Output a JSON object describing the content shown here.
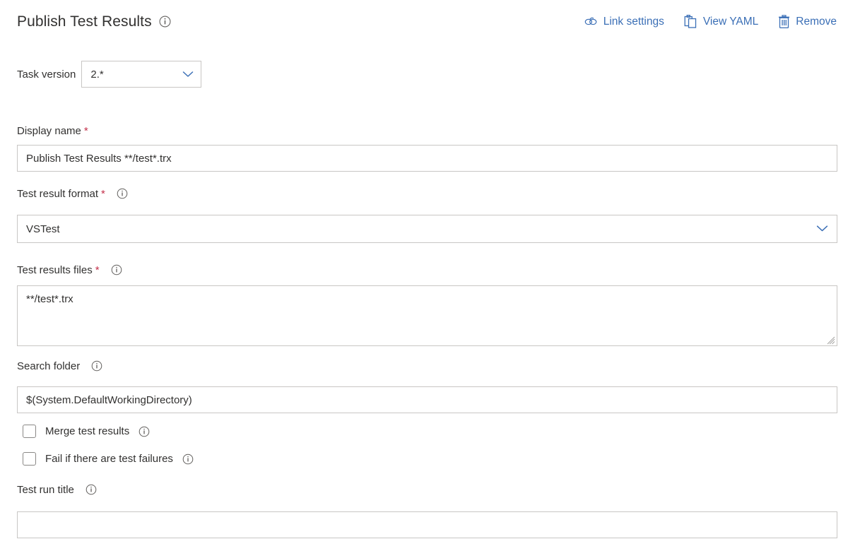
{
  "header": {
    "title": "Publish Test Results",
    "title_info_icon": "info-icon",
    "actions": [
      {
        "label": "Link settings",
        "icon": "link-icon"
      },
      {
        "label": "View YAML",
        "icon": "clipboard-icon"
      },
      {
        "label": "Remove",
        "icon": "trash-icon"
      }
    ]
  },
  "task_version": {
    "label": "Task version",
    "value": "2.*",
    "chevron_icon": "chevron-down-icon"
  },
  "fields": {
    "display_name": {
      "label": "Display name",
      "required_marker": "*",
      "value": "Publish Test Results **/test*.trx"
    },
    "test_result_format": {
      "label": "Test result format",
      "required_marker": "*",
      "info_icon": "info-icon",
      "value": "VSTest",
      "chevron_icon": "chevron-down-icon"
    },
    "test_results_files": {
      "label": "Test results files",
      "required_marker": "*",
      "info_icon": "info-icon",
      "value": "**/test*.trx"
    },
    "search_folder": {
      "label": "Search folder",
      "info_icon": "info-icon",
      "value": "$(System.DefaultWorkingDirectory)"
    },
    "merge_test_results": {
      "label": "Merge test results",
      "info_icon": "info-icon",
      "checked": false
    },
    "fail_if_test_failures": {
      "label": "Fail if there are test failures",
      "info_icon": "info-icon",
      "checked": false
    },
    "test_run_title": {
      "label": "Test run title",
      "info_icon": "info-icon",
      "value": ""
    }
  },
  "colors": {
    "link_blue": "#3b6fb6",
    "required_red": "#c4314b",
    "border_grey": "#c8c6c4",
    "text": "#323130"
  }
}
